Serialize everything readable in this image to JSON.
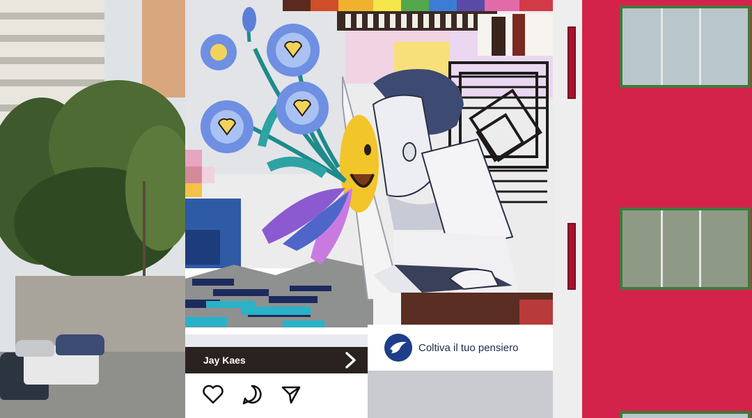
{
  "post": {
    "author": "Jay Kaes",
    "tagline": "Coltiva il tuo pensiero",
    "actions": [
      "heart-icon",
      "comment-icon",
      "share-icon"
    ],
    "next_icon": "chevron-right-icon"
  },
  "colors": {
    "mural_dark": "#2a221e",
    "brand_blue": "#1e3e8a",
    "building_red": "#d4234a",
    "window_green": "#3f7a3a",
    "flower_blue": "#5b7fd6",
    "smiley_yellow": "#f2c52b"
  }
}
